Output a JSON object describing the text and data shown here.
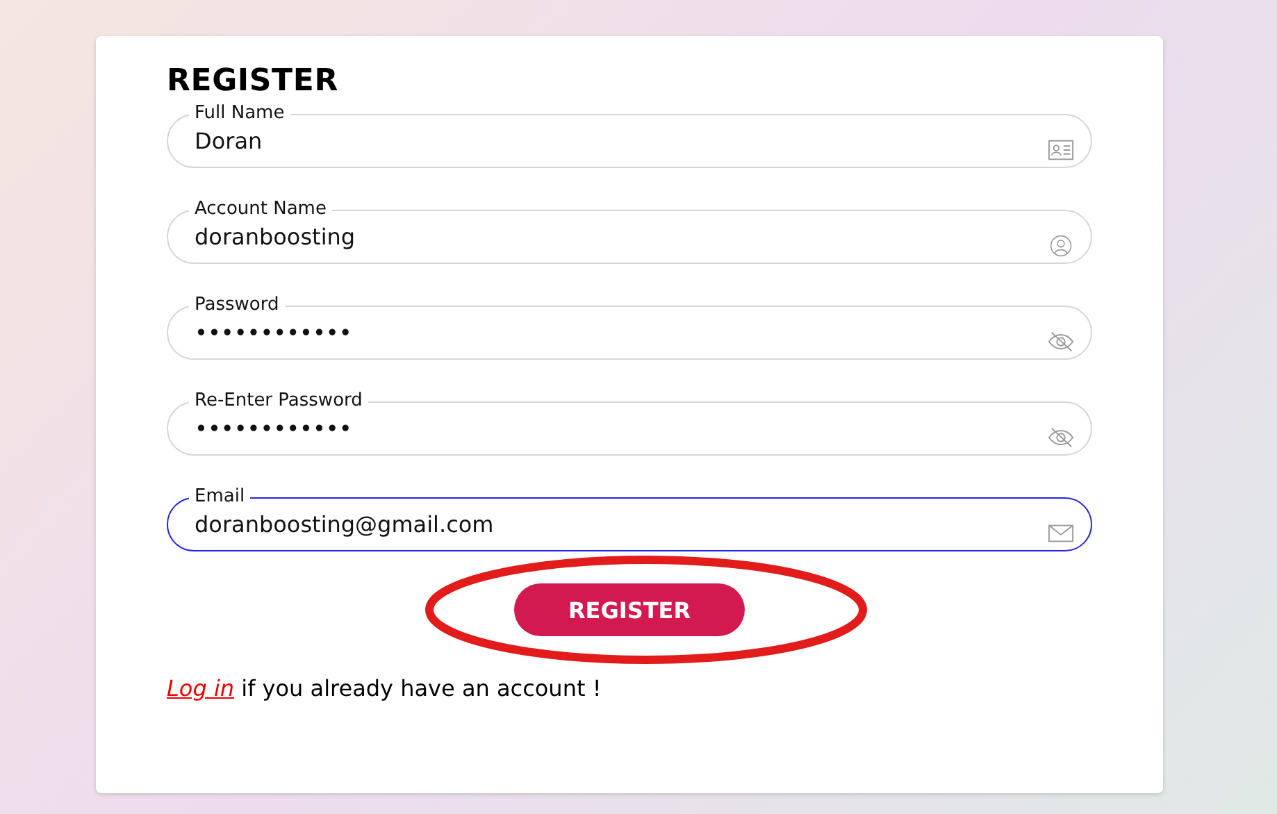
{
  "title": "REGISTER",
  "fields": [
    {
      "label": "Full Name",
      "value": "Doran",
      "kind": "card",
      "focused": false
    },
    {
      "label": "Account Name",
      "value": "doranboosting",
      "kind": "user",
      "focused": false
    },
    {
      "label": "Password",
      "value": "••••••••••••",
      "kind": "eye",
      "focused": false
    },
    {
      "label": "Re-Enter Password",
      "value": "••••••••••••",
      "kind": "eye",
      "focused": false
    },
    {
      "label": "Email",
      "value": "doranboosting@gmail.com",
      "kind": "mail",
      "focused": true
    }
  ],
  "submit": "REGISTER",
  "footer": {
    "link": "Log in",
    "text": "if you already have an account !"
  }
}
